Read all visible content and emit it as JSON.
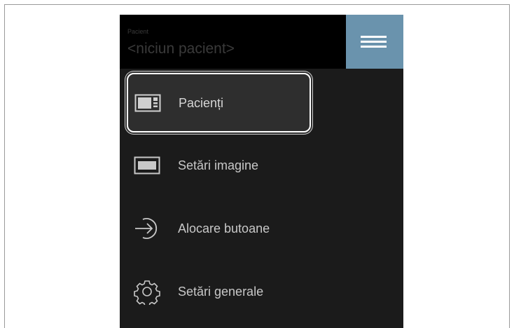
{
  "header": {
    "patient_label": "Pacient",
    "patient_value": "<niciun pacient>",
    "menu_icon": "hamburger-menu-icon"
  },
  "menu": {
    "items": [
      {
        "label": "Pacienți",
        "icon": "patient-card-icon",
        "selected": true
      },
      {
        "label": "Setări imagine",
        "icon": "image-frame-icon",
        "selected": false
      },
      {
        "label": "Alocare butoane",
        "icon": "arrow-enter-circle-icon",
        "selected": false
      },
      {
        "label": "Setări generale",
        "icon": "gear-icon",
        "selected": false
      }
    ]
  },
  "colors": {
    "accent": "#6a93ad",
    "panel_background": "#1b1b1b",
    "header_background": "#000000",
    "selected_item_background": "#2e2e2e"
  }
}
